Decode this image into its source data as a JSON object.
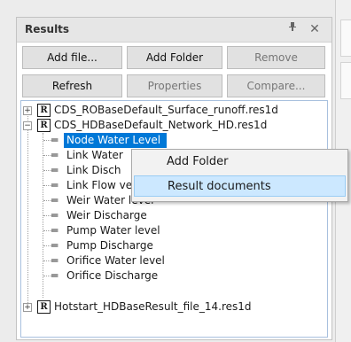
{
  "panel": {
    "title": "Results",
    "pin_icon": "pin-icon",
    "close_icon": "close-icon"
  },
  "toolbar": {
    "add_file": "Add file...",
    "add_folder": "Add Folder",
    "remove": "Remove",
    "refresh": "Refresh",
    "properties": "Properties",
    "compare": "Compare..."
  },
  "tree": {
    "file_icon_letter": "R",
    "files": [
      {
        "label": "CDS_ROBaseDefault_Surface_runoff.res1d",
        "expanded": false
      },
      {
        "label": "CDS_HDBaseDefault_Network_HD.res1d",
        "expanded": true
      },
      {
        "label": "Hotstart_HDBaseResult_file_14.res1d",
        "expanded": false
      }
    ],
    "items": [
      "Node Water Level",
      "Link Water",
      "Link Disch",
      "Link Flow velocity",
      "Weir Water level",
      "Weir Discharge",
      "Pump Water level",
      "Pump Discharge",
      "Orifice Water level",
      "Orifice Discharge"
    ],
    "selected_index": 0
  },
  "context_menu": {
    "items": [
      "Add Folder",
      "Result documents"
    ],
    "hover_index": 1
  },
  "colors": {
    "selection": "#0078d7",
    "menu_hover": "#cce8ff"
  }
}
